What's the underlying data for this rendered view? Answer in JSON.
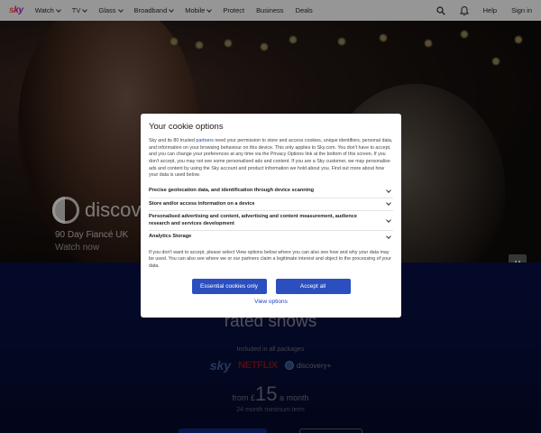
{
  "nav": {
    "logo": "sky",
    "items": [
      {
        "label": "Watch",
        "dropdown": true
      },
      {
        "label": "TV",
        "dropdown": true
      },
      {
        "label": "Glass",
        "dropdown": true
      },
      {
        "label": "Broadband",
        "dropdown": true
      },
      {
        "label": "Mobile",
        "dropdown": true
      },
      {
        "label": "Protect",
        "dropdown": false
      },
      {
        "label": "Business",
        "dropdown": false
      },
      {
        "label": "Deals",
        "dropdown": false
      }
    ],
    "help": "Help",
    "signin": "Sign in",
    "icons": [
      "search-icon",
      "bell-icon"
    ]
  },
  "hero": {
    "brand": "discove",
    "show_title": "90 Day Fiancé UK",
    "cta": "Watch now"
  },
  "lower": {
    "headline": "rated shows",
    "included": "Included in all packages",
    "logos": [
      "sky",
      "NETFLIX",
      "discovery+"
    ],
    "price_prefix": "from",
    "currency": "£",
    "price": "15",
    "price_suffix": "a month",
    "term": "24 month minimum term"
  },
  "modal": {
    "title": "Your cookie options",
    "intro_before_link": "Sky and its 80 trusted ",
    "intro_link": "partners",
    "intro_after_link": " need your permission to store and access cookies, unique identifiers, personal data, and information on your browsing behaviour on this device. This only applies to Sky.com. You don't have to accept, and you can change your preferences at any time via the Privacy Options link at the bottom of this screen. If you don't accept, you may not see some personalised ads and content. If you are a Sky customer, we may personalise ads and content by using the Sky account and product information we hold about you. Find out more about how your data is used below.",
    "rows": [
      "Precise geolocation data, and identification through device scanning",
      "Store and/or access information on a device",
      "Personalised advertising and content, advertising and content measurement, audience research and services development",
      "Analytics Storage"
    ],
    "footer": "If you don't want to accept, please select View options below where you can also see how and why your data may be used. You can also see where we or our partners claim a legitimate interest and object to the processing of your data.",
    "essential_button": "Essential cookies only",
    "accept_button": "Accept all",
    "view_options": "View options"
  },
  "colors": {
    "accent": "#2b4fbf",
    "link": "#1f3fbf",
    "lower_bg": "#0c1a6a",
    "netflix": "#c3202a"
  }
}
